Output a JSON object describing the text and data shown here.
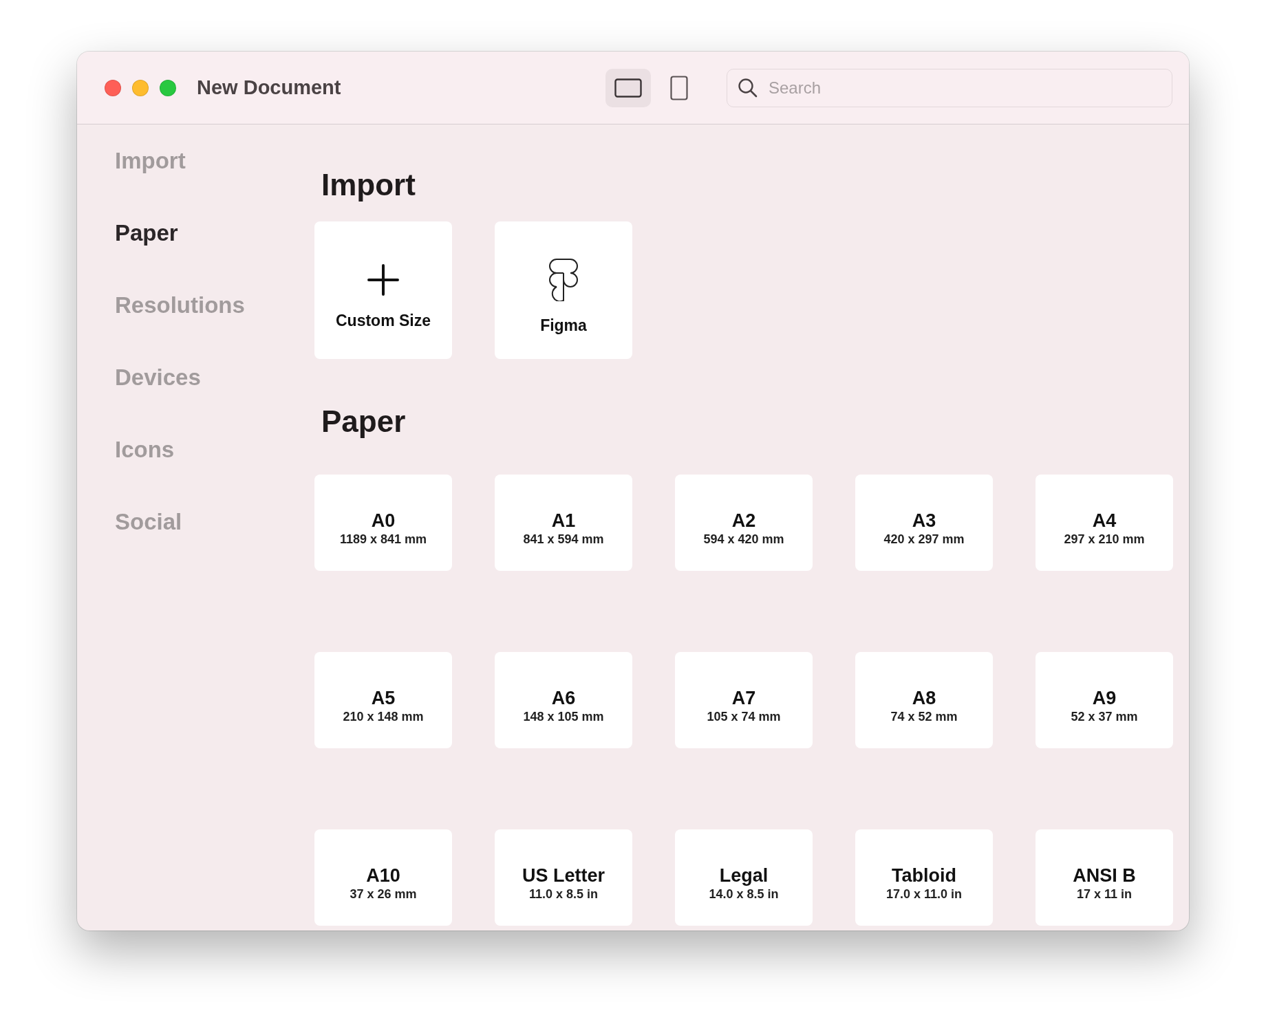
{
  "window": {
    "title": "New Document"
  },
  "view_toggle": [
    {
      "kind": "landscape",
      "selected": true
    },
    {
      "kind": "portrait",
      "selected": false
    }
  ],
  "search": {
    "placeholder": "Search"
  },
  "sidebar": {
    "items": [
      {
        "label": "Import",
        "selected": false
      },
      {
        "label": "Paper",
        "selected": true
      },
      {
        "label": "Resolutions",
        "selected": false
      },
      {
        "label": "Devices",
        "selected": false
      },
      {
        "label": "Icons",
        "selected": false
      },
      {
        "label": "Social",
        "selected": false
      }
    ]
  },
  "sections": [
    {
      "title": "Import",
      "kind": "import",
      "items": [
        {
          "kind": "plus",
          "label": "Custom Size"
        },
        {
          "kind": "figma",
          "label": "Figma"
        }
      ]
    },
    {
      "title": "Paper",
      "kind": "paper",
      "items": [
        {
          "name": "A0",
          "size": "1189 x 841 mm"
        },
        {
          "name": "A1",
          "size": "841 x 594 mm"
        },
        {
          "name": "A2",
          "size": "594 x 420 mm"
        },
        {
          "name": "A3",
          "size": "420 x 297 mm"
        },
        {
          "name": "A4",
          "size": "297 x 210 mm"
        },
        {
          "name": "A5",
          "size": "210 x 148 mm"
        },
        {
          "name": "A6",
          "size": "148 x 105 mm"
        },
        {
          "name": "A7",
          "size": "105 x 74 mm"
        },
        {
          "name": "A8",
          "size": "74 x 52 mm"
        },
        {
          "name": "A9",
          "size": "52 x 37 mm"
        },
        {
          "name": "A10",
          "size": "37 x 26 mm"
        },
        {
          "name": "US Letter",
          "size": "11.0 x 8.5 in"
        },
        {
          "name": "Legal",
          "size": "14.0 x 8.5 in"
        },
        {
          "name": "Tabloid",
          "size": "17.0 x 11.0 in"
        },
        {
          "name": "ANSI B",
          "size": "17 x 11 in"
        }
      ]
    }
  ]
}
